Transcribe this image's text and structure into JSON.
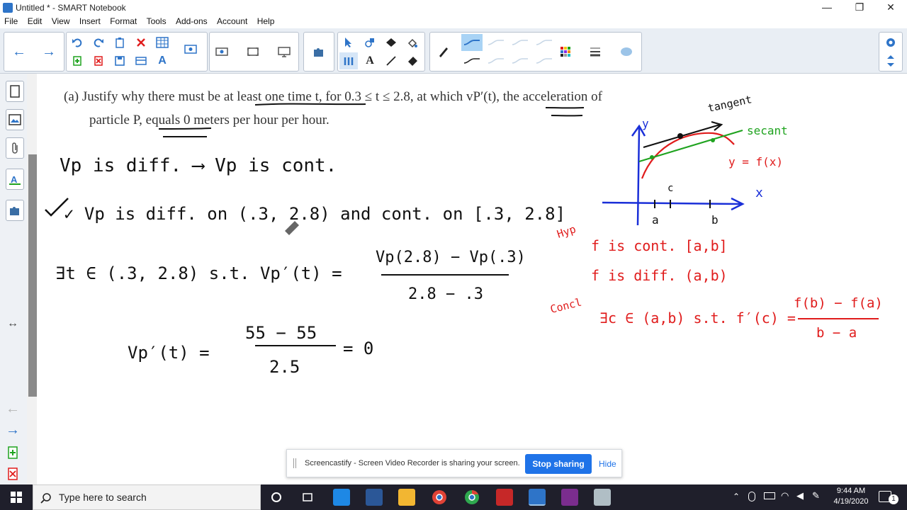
{
  "window": {
    "title": "Untitled * - SMART Notebook",
    "minimize_glyph": "—",
    "restore_glyph": "❐",
    "close_glyph": "✕"
  },
  "menu": [
    "File",
    "Edit",
    "View",
    "Insert",
    "Format",
    "Tools",
    "Add-ons",
    "Account",
    "Help"
  ],
  "toolbar": {
    "back_glyph": "←",
    "forward_glyph": "→",
    "text_tool_glyph": "A",
    "accent_color": "#2e74c8",
    "active_line_color": "#a9d3f5"
  },
  "sidebar": {
    "tabs": [
      "page-sorter-icon",
      "gallery-icon",
      "attachments-icon",
      "properties-icon",
      "addons-icon"
    ],
    "move_glyph": "↔"
  },
  "canvas": {
    "problem_line1": "(a)  Justify why there must be at least one time t, for 0.3 ≤ t ≤ 2.8, at which vP′(t), the acceleration of",
    "problem_line2": "particle P, equals 0 meters per hour per hour.",
    "handwriting": {
      "line1": "Vp is diff. ⟶ Vp is cont.",
      "line2": "✓ Vp is diff. on (.3, 2.8) and cont. on [.3, 2.8]",
      "line3_left": "∃t ∈ (.3, 2.8) s.t. Vp′(t) =",
      "line3_num": "Vp(2.8) − Vp(.3)",
      "line3_den": "2.8 − .3",
      "line4_left": "Vp′(t) =",
      "line4_num": "55 − 55",
      "line4_den": "2.5",
      "line4_right": "= 0",
      "graph_y": "y",
      "graph_x": "x",
      "graph_tangent": "tangent",
      "graph_secant": "secant",
      "graph_func": "y = f(x)",
      "graph_c": "c",
      "graph_a": "a",
      "graph_b": "b",
      "hyp_label": "Hyp",
      "hyp1": "f is cont. [a,b]",
      "hyp2": "f is diff. (a,b)",
      "concl_label": "Concl",
      "concl": "∃c ∈ (a,b) s.t. f′(c) =",
      "concl_num": "f(b) − f(a)",
      "concl_den": "b − a"
    },
    "ink_black": "#111111",
    "ink_blue": "#1a2fd8",
    "ink_red": "#e01c1c",
    "ink_green": "#1fa31f"
  },
  "share": {
    "message": "Screencastify - Screen Video Recorder is sharing your screen.",
    "stop_label": "Stop sharing",
    "hide_label": "Hide",
    "button_color": "#1f73e8"
  },
  "taskbar": {
    "search_placeholder": "Type here to search",
    "time": "9:44 AM",
    "date": "4/19/2020",
    "notification_count": "1"
  }
}
